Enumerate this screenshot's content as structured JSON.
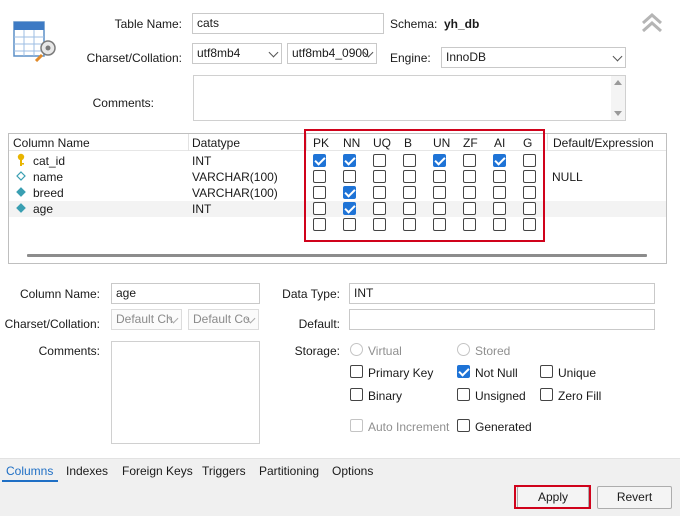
{
  "header": {
    "table_name_label": "Table Name:",
    "table_name_value": "cats",
    "schema_label": "Schema:",
    "schema_value": "yh_db",
    "charset_label": "Charset/Collation:",
    "charset_value": "utf8mb4",
    "collation_value": "utf8mb4_0900",
    "engine_label": "Engine:",
    "engine_value": "InnoDB",
    "comments_label": "Comments:"
  },
  "grid": {
    "headers": [
      "Column Name",
      "Datatype",
      "PK",
      "NN",
      "UQ",
      "B",
      "UN",
      "ZF",
      "AI",
      "G",
      "Default/Expression"
    ],
    "rows": [
      {
        "name": "cat_id",
        "type": "INT",
        "flags": [
          true,
          true,
          false,
          false,
          true,
          false,
          true,
          false
        ],
        "default": "",
        "icon": "primary-key-icon"
      },
      {
        "name": "name",
        "type": "VARCHAR(100)",
        "flags": [
          false,
          false,
          false,
          false,
          false,
          false,
          false,
          false
        ],
        "default": "NULL",
        "icon": "column-diamond-icon"
      },
      {
        "name": "breed",
        "type": "VARCHAR(100)",
        "flags": [
          false,
          true,
          false,
          false,
          false,
          false,
          false,
          false
        ],
        "default": "",
        "icon": "column-diamond-filled-icon"
      },
      {
        "name": "age",
        "type": "INT",
        "flags": [
          false,
          true,
          false,
          false,
          false,
          false,
          false,
          false
        ],
        "default": "",
        "icon": "column-diamond-filled-icon"
      },
      {
        "name": "",
        "type": "",
        "flags": [
          false,
          false,
          false,
          false,
          false,
          false,
          false,
          false
        ],
        "default": "",
        "icon": ""
      }
    ]
  },
  "details": {
    "column_name_label": "Column Name:",
    "column_name_value": "age",
    "charset_label": "Charset/Collation:",
    "charset_value": "Default Ch",
    "collation_value": "Default Co",
    "comments_label": "Comments:",
    "data_type_label": "Data Type:",
    "data_type_value": "INT",
    "default_label": "Default:",
    "default_value": "",
    "storage_label": "Storage:",
    "virtual_label": "Virtual",
    "stored_label": "Stored",
    "primary_key_label": "Primary Key",
    "not_null_label": "Not Null",
    "unique_label": "Unique",
    "binary_label": "Binary",
    "unsigned_label": "Unsigned",
    "zero_fill_label": "Zero Fill",
    "auto_increment_label": "Auto Increment",
    "generated_label": "Generated"
  },
  "tabs": [
    "Columns",
    "Indexes",
    "Foreign Keys",
    "Triggers",
    "Partitioning",
    "Options"
  ],
  "buttons": {
    "apply": "Apply",
    "revert": "Revert"
  },
  "colors": {
    "accent": "#1e73d6",
    "highlight": "#d0021b",
    "active_tab": "#1f6fc5"
  }
}
